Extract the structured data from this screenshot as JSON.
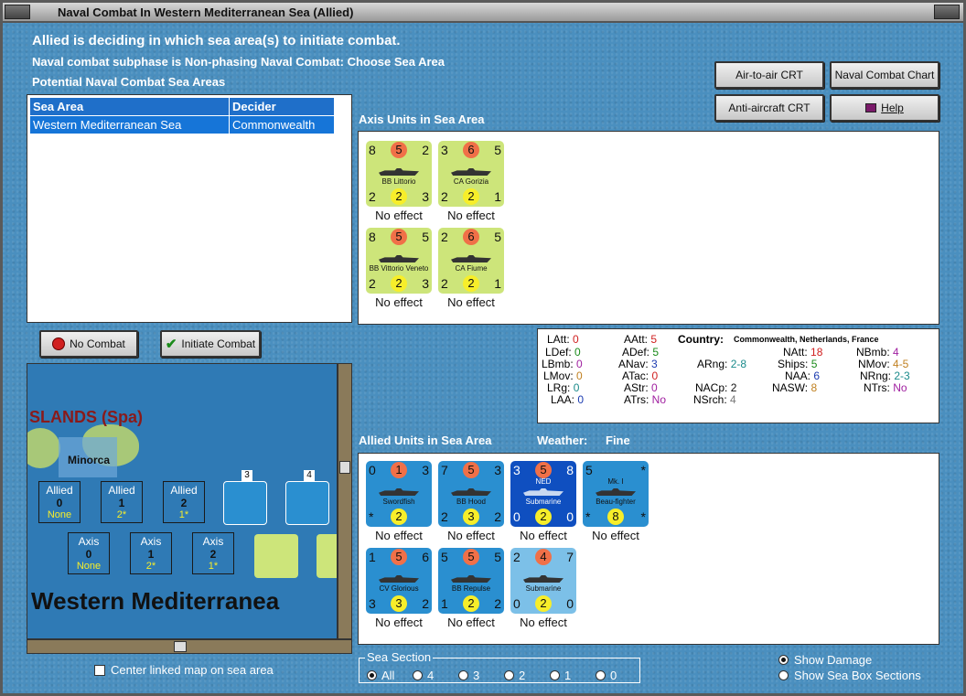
{
  "window": {
    "title": "Naval Combat In Western Mediterranean Sea (Allied)"
  },
  "header": {
    "line1": "Allied is deciding in which sea area(s) to initiate combat.",
    "line2": "Naval combat subphase is Non-phasing Naval Combat: Choose Sea Area",
    "line3": "Potential Naval Combat Sea Areas"
  },
  "buttons": {
    "air_to_air": "Air-to-air CRT",
    "naval_combat_chart": "Naval Combat Chart",
    "anti_aircraft": "Anti-aircraft CRT",
    "help": "Help",
    "no_combat": "No Combat",
    "initiate_combat": "Initiate Combat"
  },
  "sea_table": {
    "headers": [
      "Sea Area",
      "Decider"
    ],
    "rows": [
      [
        "Western Mediterranean Sea",
        "Commonwealth"
      ]
    ]
  },
  "axis": {
    "label": "Axis Units in Sea Area",
    "units": [
      {
        "tl": "8",
        "tc": "5",
        "tr": "2",
        "name": "BB Littorio",
        "bl": "2",
        "bc": "2",
        "br": "3",
        "effect": "No effect"
      },
      {
        "tl": "3",
        "tc": "6",
        "tr": "5",
        "name": "CA Gorizia",
        "bl": "2",
        "bc": "2",
        "br": "1",
        "effect": "No effect"
      },
      {
        "tl": "8",
        "tc": "5",
        "tr": "5",
        "name": "BB Vittorio Veneto",
        "bl": "2",
        "bc": "2",
        "br": "3",
        "effect": "No effect"
      },
      {
        "tl": "2",
        "tc": "6",
        "tr": "5",
        "name": "CA Fiume",
        "bl": "2",
        "bc": "2",
        "br": "1",
        "effect": "No effect"
      }
    ]
  },
  "stats": {
    "LAtt": "0",
    "LDef": "0",
    "LBmb": "0",
    "LMov": "0",
    "LRg": "0",
    "LAA": "0",
    "AAtt": "5",
    "ADef": "5",
    "ANav": "3",
    "ATac": "0",
    "AStr": "0",
    "ATrs": "No",
    "country_label": "Country:",
    "country": "Commonwealth, Netherlands, France",
    "ARng": "2-8",
    "NACp": "2",
    "NSrch": "4",
    "NAtt": "18",
    "Ships": "5",
    "NAA": "6",
    "NASW": "8",
    "NBmb": "4",
    "NMov": "4-5",
    "NRng": "2-3",
    "NTrs": "No"
  },
  "allied": {
    "label": "Allied Units in Sea Area",
    "weather_label": "Weather:",
    "weather": "Fine",
    "units": [
      {
        "tl": "0",
        "tc": "1",
        "tr": "3",
        "name": "Swordfish",
        "bl": "*",
        "bc": "2",
        "br": "",
        "effect": "No effect"
      },
      {
        "tl": "7",
        "tc": "5",
        "tr": "3",
        "name": "BB Hood",
        "bl": "2",
        "bc": "3",
        "br": "2",
        "effect": "No effect"
      },
      {
        "tl": "3",
        "tc": "5",
        "tr": "8",
        "name": "Submarine",
        "sub": "NED",
        "bl": "0",
        "bc": "2",
        "br": "0",
        "effect": "No effect"
      },
      {
        "tl": "5",
        "tc": "",
        "tr": "*",
        "name": "Beau-fighter",
        "sub": "Mk. I",
        "bl": "*",
        "bc": "8",
        "br": "*",
        "effect": "No effect"
      },
      {
        "tl": "1",
        "tc": "5",
        "tr": "6",
        "name": "CV Glorious",
        "bl": "3",
        "bc": "3",
        "br": "2",
        "effect": "No effect"
      },
      {
        "tl": "5",
        "tc": "5",
        "tr": "5",
        "name": "BB Repulse",
        "bl": "1",
        "bc": "2",
        "br": "2",
        "effect": "No effect"
      },
      {
        "tl": "2",
        "tc": "4",
        "tr": "7",
        "name": "Submarine",
        "bl": "0",
        "bc": "2",
        "br": "0",
        "effect": "No effect"
      }
    ]
  },
  "map": {
    "islands_label": "SLANDS (Spa)",
    "minorca": "Minorca",
    "sea_name": "Western Mediterranea",
    "allied_boxes": [
      {
        "side": "Allied",
        "num": "0",
        "val": "None"
      },
      {
        "side": "Allied",
        "num": "1",
        "val": "2*"
      },
      {
        "side": "Allied",
        "num": "2",
        "val": "1*"
      }
    ],
    "axis_boxes": [
      {
        "side": "Axis",
        "num": "0",
        "val": "None"
      },
      {
        "side": "Axis",
        "num": "1",
        "val": "2*"
      },
      {
        "side": "Axis",
        "num": "2",
        "val": "1*"
      }
    ],
    "counter_nums": [
      "3",
      "4"
    ]
  },
  "options": {
    "center_map": "Center linked map on sea area",
    "sea_section": "Sea Section",
    "sections": [
      "All",
      "4",
      "3",
      "2",
      "1",
      "0"
    ],
    "show_damage": "Show Damage",
    "show_sea_box": "Show Sea Box Sections"
  },
  "colors": {
    "panel_bg": "#4a8fbf",
    "axis_counter": "#cde57a",
    "allied_counter": "#2a8fd0",
    "selected_row": "#1675d8"
  }
}
